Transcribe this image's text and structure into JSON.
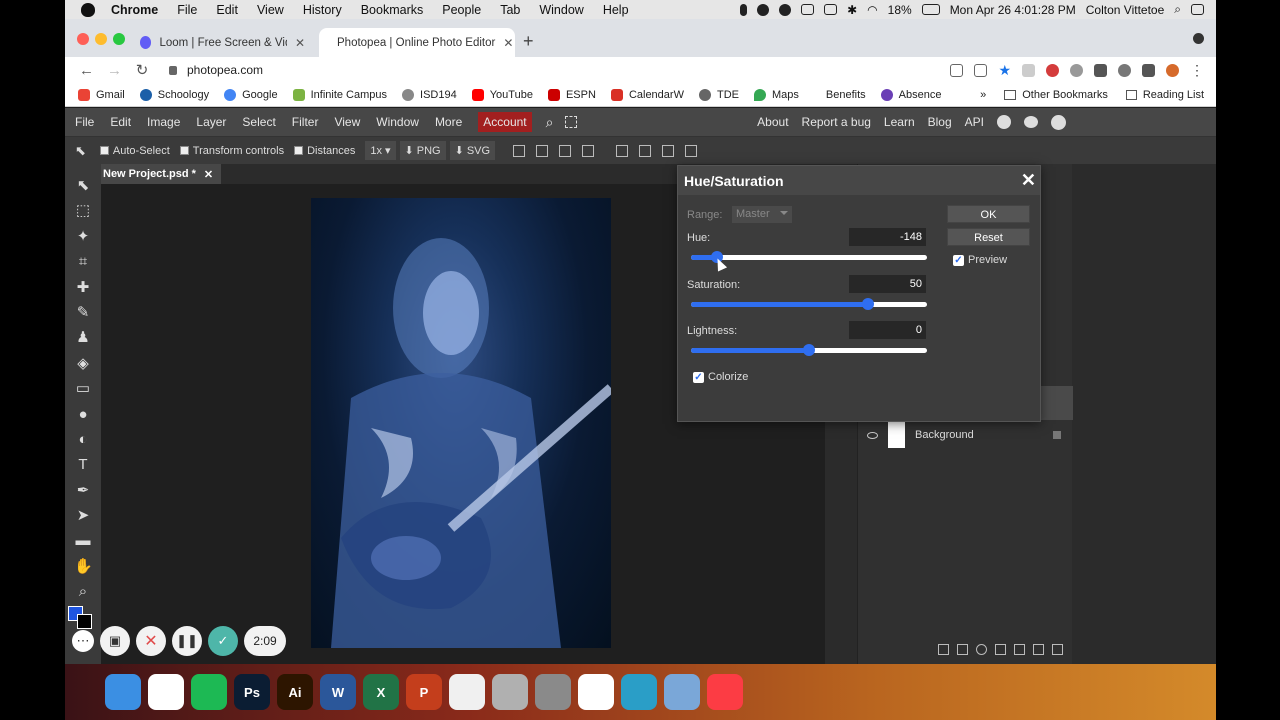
{
  "menubar": {
    "app": "Chrome",
    "items": [
      "File",
      "Edit",
      "View",
      "History",
      "Bookmarks",
      "People",
      "Tab",
      "Window",
      "Help"
    ],
    "battery": "18%",
    "clock": "Mon Apr 26  4:01:28 PM",
    "user": "Colton Vittetoe"
  },
  "tabs": [
    {
      "title": "Loom | Free Screen & Video Re",
      "color": "#625df5"
    },
    {
      "title": "Photopea | Online Photo Editor",
      "color": "#18a497"
    }
  ],
  "address": {
    "url": "photopea.com"
  },
  "bookmarks": {
    "items": [
      {
        "label": "Gmail",
        "color": "#ea4335"
      },
      {
        "label": "Schoology",
        "color": "#1b5fa8"
      },
      {
        "label": "Google",
        "color": "#4285f4"
      },
      {
        "label": "Infinite Campus",
        "color": "#7cb342"
      },
      {
        "label": "ISD194",
        "color": "#888888"
      },
      {
        "label": "YouTube",
        "color": "#ff0000"
      },
      {
        "label": "ESPN",
        "color": "#cc0000"
      },
      {
        "label": "CalendarW",
        "color": "#d93025"
      },
      {
        "label": "TDE",
        "color": "#666666"
      },
      {
        "label": "Maps",
        "color": "#34a853"
      },
      {
        "label": "Benefits",
        "color": "#ffffff"
      },
      {
        "label": "Absence",
        "color": "#6a3fb5"
      }
    ],
    "overflow": "»",
    "other": "Other Bookmarks",
    "reading": "Reading List"
  },
  "photopea": {
    "menu": [
      "File",
      "Edit",
      "Image",
      "Layer",
      "Select",
      "Filter",
      "View",
      "Window",
      "More"
    ],
    "account": "Account",
    "right_links": [
      "About",
      "Report a bug",
      "Learn",
      "Blog",
      "API"
    ],
    "options": {
      "auto_select": "Auto-Select",
      "transform": "Transform controls",
      "distances": "Distances",
      "zoom": "1x",
      "png": "PNG",
      "svg": "SVG"
    },
    "doc_tab": "New Project.psd *",
    "layers": {
      "background": "Background"
    }
  },
  "dialog": {
    "title": "Hue/Saturation",
    "range_label": "Range:",
    "range_value": "Master",
    "hue_label": "Hue:",
    "hue_value": "-148",
    "hue_fraction": 0.11,
    "saturation_label": "Saturation:",
    "saturation_value": "50",
    "saturation_fraction": 0.75,
    "lightness_label": "Lightness:",
    "lightness_value": "0",
    "lightness_fraction": 0.5,
    "colorize_label": "Colorize",
    "colorize_checked": true,
    "ok": "OK",
    "reset": "Reset",
    "preview_label": "Preview",
    "preview_checked": true
  },
  "loom": {
    "timer": "2:09"
  },
  "dock": {
    "apps": [
      {
        "name": "Finder",
        "color": "#3b8fe3",
        "text": ""
      },
      {
        "name": "Chrome",
        "color": "#ffffff",
        "text": ""
      },
      {
        "name": "Spotify",
        "color": "#1db954",
        "text": ""
      },
      {
        "name": "Photoshop",
        "color": "#0b1d33",
        "text": "Ps"
      },
      {
        "name": "Illustrator",
        "color": "#2d1500",
        "text": "Ai"
      },
      {
        "name": "Word",
        "color": "#2b579a",
        "text": "W"
      },
      {
        "name": "Excel",
        "color": "#217346",
        "text": "X"
      },
      {
        "name": "PowerPoint",
        "color": "#c43e1c",
        "text": "P"
      },
      {
        "name": "Photos",
        "color": "#f0f0f0",
        "text": ""
      },
      {
        "name": "Calculator",
        "color": "#b0b0b0",
        "text": ""
      },
      {
        "name": "System Preferences",
        "color": "#8a8a8a",
        "text": ""
      },
      {
        "name": "Slack",
        "color": "#ffffff",
        "text": ""
      },
      {
        "name": "Camo",
        "color": "#2a9ec7",
        "text": ""
      },
      {
        "name": "Preview",
        "color": "#7aa7d8",
        "text": ""
      },
      {
        "name": "Music",
        "color": "#fc3c44",
        "text": ""
      }
    ]
  }
}
